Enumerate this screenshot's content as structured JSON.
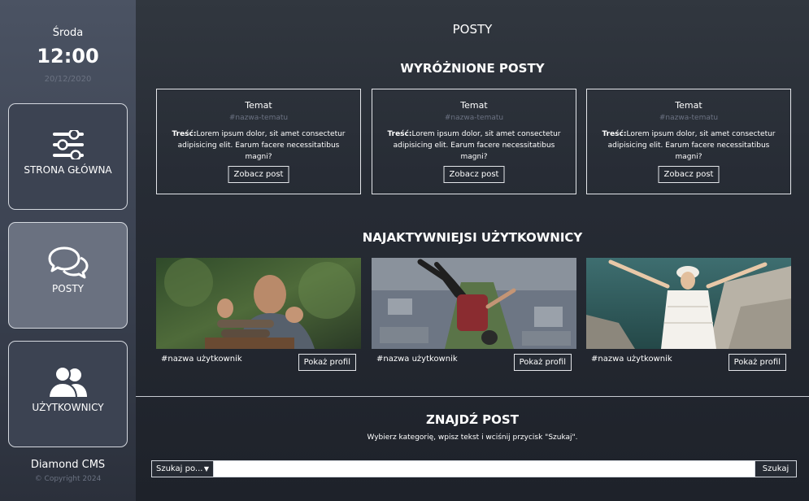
{
  "sidebar": {
    "day": "Środa",
    "time": "12:00",
    "date": "20/12/2020",
    "nav": [
      {
        "label": "STRONA GŁÓWNA",
        "icon": "sliders-icon"
      },
      {
        "label": "POSTY",
        "icon": "chat-bubbles-icon"
      },
      {
        "label": "UŻYTKOWNICY",
        "icon": "users-icon"
      }
    ],
    "brand": "Diamond CMS",
    "copyright": "© Copyright 2024"
  },
  "main": {
    "page_title": "POSTY",
    "featured_title": "WYRÓŻNIONE POSTY",
    "posts": [
      {
        "topic": "Temat",
        "tag": "#nazwa-tematu",
        "content_label": "Treść:",
        "content": "Lorem ipsum dolor, sit amet consectetur adipisicing elit. Earum facere necessitatibus magni?",
        "button": "Zobacz post"
      },
      {
        "topic": "Temat",
        "tag": "#nazwa-tematu",
        "content_label": "Treść:",
        "content": "Lorem ipsum dolor, sit amet consectetur adipisicing elit. Earum facere necessitatibus magni?",
        "button": "Zobacz post"
      },
      {
        "topic": "Temat",
        "tag": "#nazwa-tematu",
        "content_label": "Treść:",
        "content": "Lorem ipsum dolor, sit amet consectetur adipisicing elit. Earum facere necessitatibus magni?",
        "button": "Zobacz post"
      }
    ],
    "active_title": "NAJAKTYWNIEJSI UŻYTKOWNICY",
    "users": [
      {
        "name": "#nazwa użytkownik",
        "button": "Pokaż profil"
      },
      {
        "name": "#nazwa użytkownik",
        "button": "Pokaż profil"
      },
      {
        "name": "#nazwa użytkownik",
        "button": "Pokaż profil"
      }
    ],
    "search_title": "ZNAJDŹ POST",
    "search_hint": "Wybierz kategorię, wpisz tekst i wciśnij przycisk \"Szukaj\".",
    "search": {
      "select_label": "Szukaj po...",
      "input_value": "",
      "button": "Szukaj"
    }
  }
}
